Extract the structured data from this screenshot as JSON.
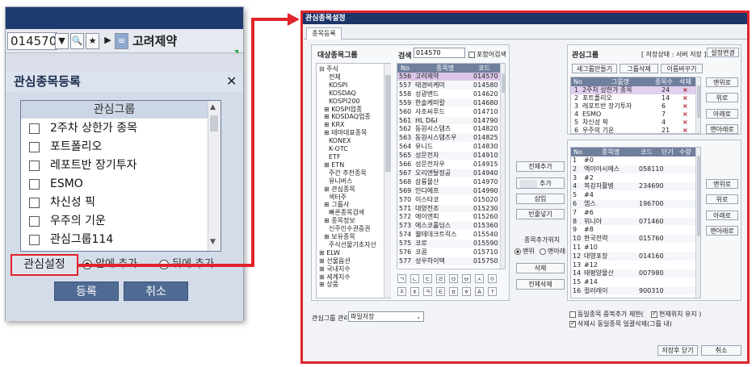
{
  "left_panel": {
    "stock_code": "014570",
    "stock_name": "고려제약",
    "dialog_title": "관심종목등록",
    "list_header": "관심그룹",
    "groups": [
      "2주차 상한가 종목",
      "포트폴리오",
      "레포트반 장기투자",
      "ESMO",
      "차신성 픽",
      "우주의 기운",
      "관심그룹114"
    ],
    "settings_button": "관심설정",
    "radio_front": "앞에 추가",
    "radio_back": "뒤에 추가",
    "register_button": "등록",
    "cancel_button": "취소"
  },
  "right_panel": {
    "title": "관심종목설정",
    "tab": "종목등록",
    "target_group_label": "대상종목그룹",
    "tree": [
      "⊟ 주식",
      "전체",
      "KOSPI",
      "KOSDAQ",
      "KOSPI200",
      "⊞ KOSPI업종",
      "⊞ KOSDAQ업종",
      "⊞ KRX",
      "⊞ 테마대표종목",
      "KONEX",
      "K-OTC",
      "ETF",
      "⊞ ETN",
      "주간 추천종목",
      "유니버스",
      "⊞ 관심종목",
      "섹터주",
      "⊞ 그룹사",
      "빠른종목검색",
      "⊞ 종목정보",
      "신주인수권증권",
      "⊞ 보유종목",
      "주식선물기초자산",
      "⊞ ELW",
      "⊞ 선물옵션",
      "⊞ 국내지수",
      "⊞ 세계지수",
      "⊞ 상품"
    ],
    "search_label": "검색",
    "search_value": "014570",
    "include_search_label": "포함어검색",
    "stock_grid_headers": [
      "No",
      "종목명",
      "코드"
    ],
    "stock_rows": [
      [
        "556",
        "고려제약",
        "014570"
      ],
      [
        "557",
        "태경비케미",
        "014580"
      ],
      [
        "558",
        "성광밴드",
        "014620"
      ],
      [
        "559",
        "한솔케미칼",
        "014680"
      ],
      [
        "560",
        "사조씨푸드",
        "014710"
      ],
      [
        "561",
        "HL D&I",
        "014790"
      ],
      [
        "562",
        "동원시스템즈",
        "014820"
      ],
      [
        "563",
        "동원시스템즈우",
        "014825"
      ],
      [
        "564",
        "유니드",
        "014830"
      ],
      [
        "565",
        "성문전자",
        "014910"
      ],
      [
        "566",
        "성문전자우",
        "014915"
      ],
      [
        "567",
        "오리엔탈정공",
        "014940"
      ],
      [
        "568",
        "삼륭물산",
        "014970"
      ],
      [
        "569",
        "인디에프",
        "014990"
      ],
      [
        "570",
        "이스타코",
        "015020"
      ],
      [
        "571",
        "대양전조",
        "015230"
      ],
      [
        "572",
        "에이엔피",
        "015260"
      ],
      [
        "573",
        "에스코홀딩스",
        "015360"
      ],
      [
        "574",
        "웰테데크트릭스",
        "015540"
      ],
      [
        "575",
        "코로",
        "015590"
      ],
      [
        "576",
        "코콤",
        "015710"
      ],
      [
        "577",
        "성우하이텍",
        "015750"
      ]
    ],
    "symbol_row1": [
      "ㄱ",
      "ㄴ",
      "ㄷ",
      "ㄹ",
      "ㅁ",
      "ㅂ",
      "ㅅ",
      "ㅇ"
    ],
    "symbol_row2": [
      "ㅈ",
      "ㅊ",
      "ㅋ",
      "ㅌ",
      "ㅍ",
      "ㅎ",
      "A",
      "?"
    ],
    "mid_buttons": {
      "add_all": "전체추가",
      "add": "추가",
      "insert": "삽입",
      "blank": "빈줄넣기",
      "add_position_label": "종목추가위치",
      "radio_top": "맨위",
      "radio_bottom": "맨아래",
      "delete": "삭제",
      "delete_all": "전체삭제"
    },
    "interest_group_label": "관심그룹",
    "storage_label": "[ 저장상태 : 서버 저장 ]",
    "env_button": "설정변경",
    "group_buttons": [
      "새그룹만들기",
      "그룹삭제",
      "이름바꾸기"
    ],
    "group_grid_headers": [
      "No",
      "그룹명",
      "종목수",
      "삭제"
    ],
    "group_rows": [
      [
        "1",
        "2주차 상한가 종목",
        "24",
        "×"
      ],
      [
        "2",
        "포트폴리오",
        "14",
        "×"
      ],
      [
        "3",
        "레포트반 장기투자",
        "6",
        "×"
      ],
      [
        "4",
        "ESMO",
        "7",
        "×"
      ],
      [
        "5",
        "차신성 픽",
        "4",
        "×"
      ],
      [
        "6",
        "우주의 기운",
        "21",
        "×"
      ]
    ],
    "item_grid_headers": [
      "No",
      "종목명",
      "코드",
      "단기",
      "수량"
    ],
    "item_rows": [
      [
        "1",
        "#0",
        "",
        "",
        ""
      ],
      [
        "2",
        "엑이아시에스",
        "058110",
        "",
        ""
      ],
      [
        "3",
        "#2",
        "",
        "",
        ""
      ],
      [
        "4",
        "복강자활병",
        "234690",
        "",
        ""
      ],
      [
        "5",
        "#4",
        "",
        "",
        ""
      ],
      [
        "6",
        "엠스",
        "196700",
        "",
        ""
      ],
      [
        "7",
        "#6",
        "",
        "",
        ""
      ],
      [
        "8",
        "위니아",
        "071460",
        "",
        ""
      ],
      [
        "9",
        "#8",
        "",
        "",
        ""
      ],
      [
        "10",
        "한국전력",
        "015760",
        "",
        ""
      ],
      [
        "11",
        "#10",
        "",
        "",
        ""
      ],
      [
        "12",
        "대영포장",
        "014160",
        "",
        ""
      ],
      [
        "13",
        "#12",
        "",
        "",
        ""
      ],
      [
        "14",
        "태평양물산",
        "007980",
        "",
        ""
      ],
      [
        "15",
        "#14",
        "",
        "",
        ""
      ],
      [
        "16",
        "컬러레이",
        "900310",
        "",
        ""
      ]
    ],
    "side_buttons_top": [
      "맨위로",
      "위로",
      "아래로",
      "맨아래로"
    ],
    "side_buttons_bottom": [
      "맨위로",
      "위로",
      "아래로",
      "맨아래로"
    ],
    "check_dup": "동일종목 중복추가 제한(",
    "check_keep": "현재위치 유지 )",
    "check_delete_same": "삭제시 동일종목 일괄삭제(그룹 내)",
    "manage_label": "관심그룹 관리",
    "manage_value": "파일저장",
    "save_close": "저장후 닫기",
    "cancel": "취소"
  }
}
